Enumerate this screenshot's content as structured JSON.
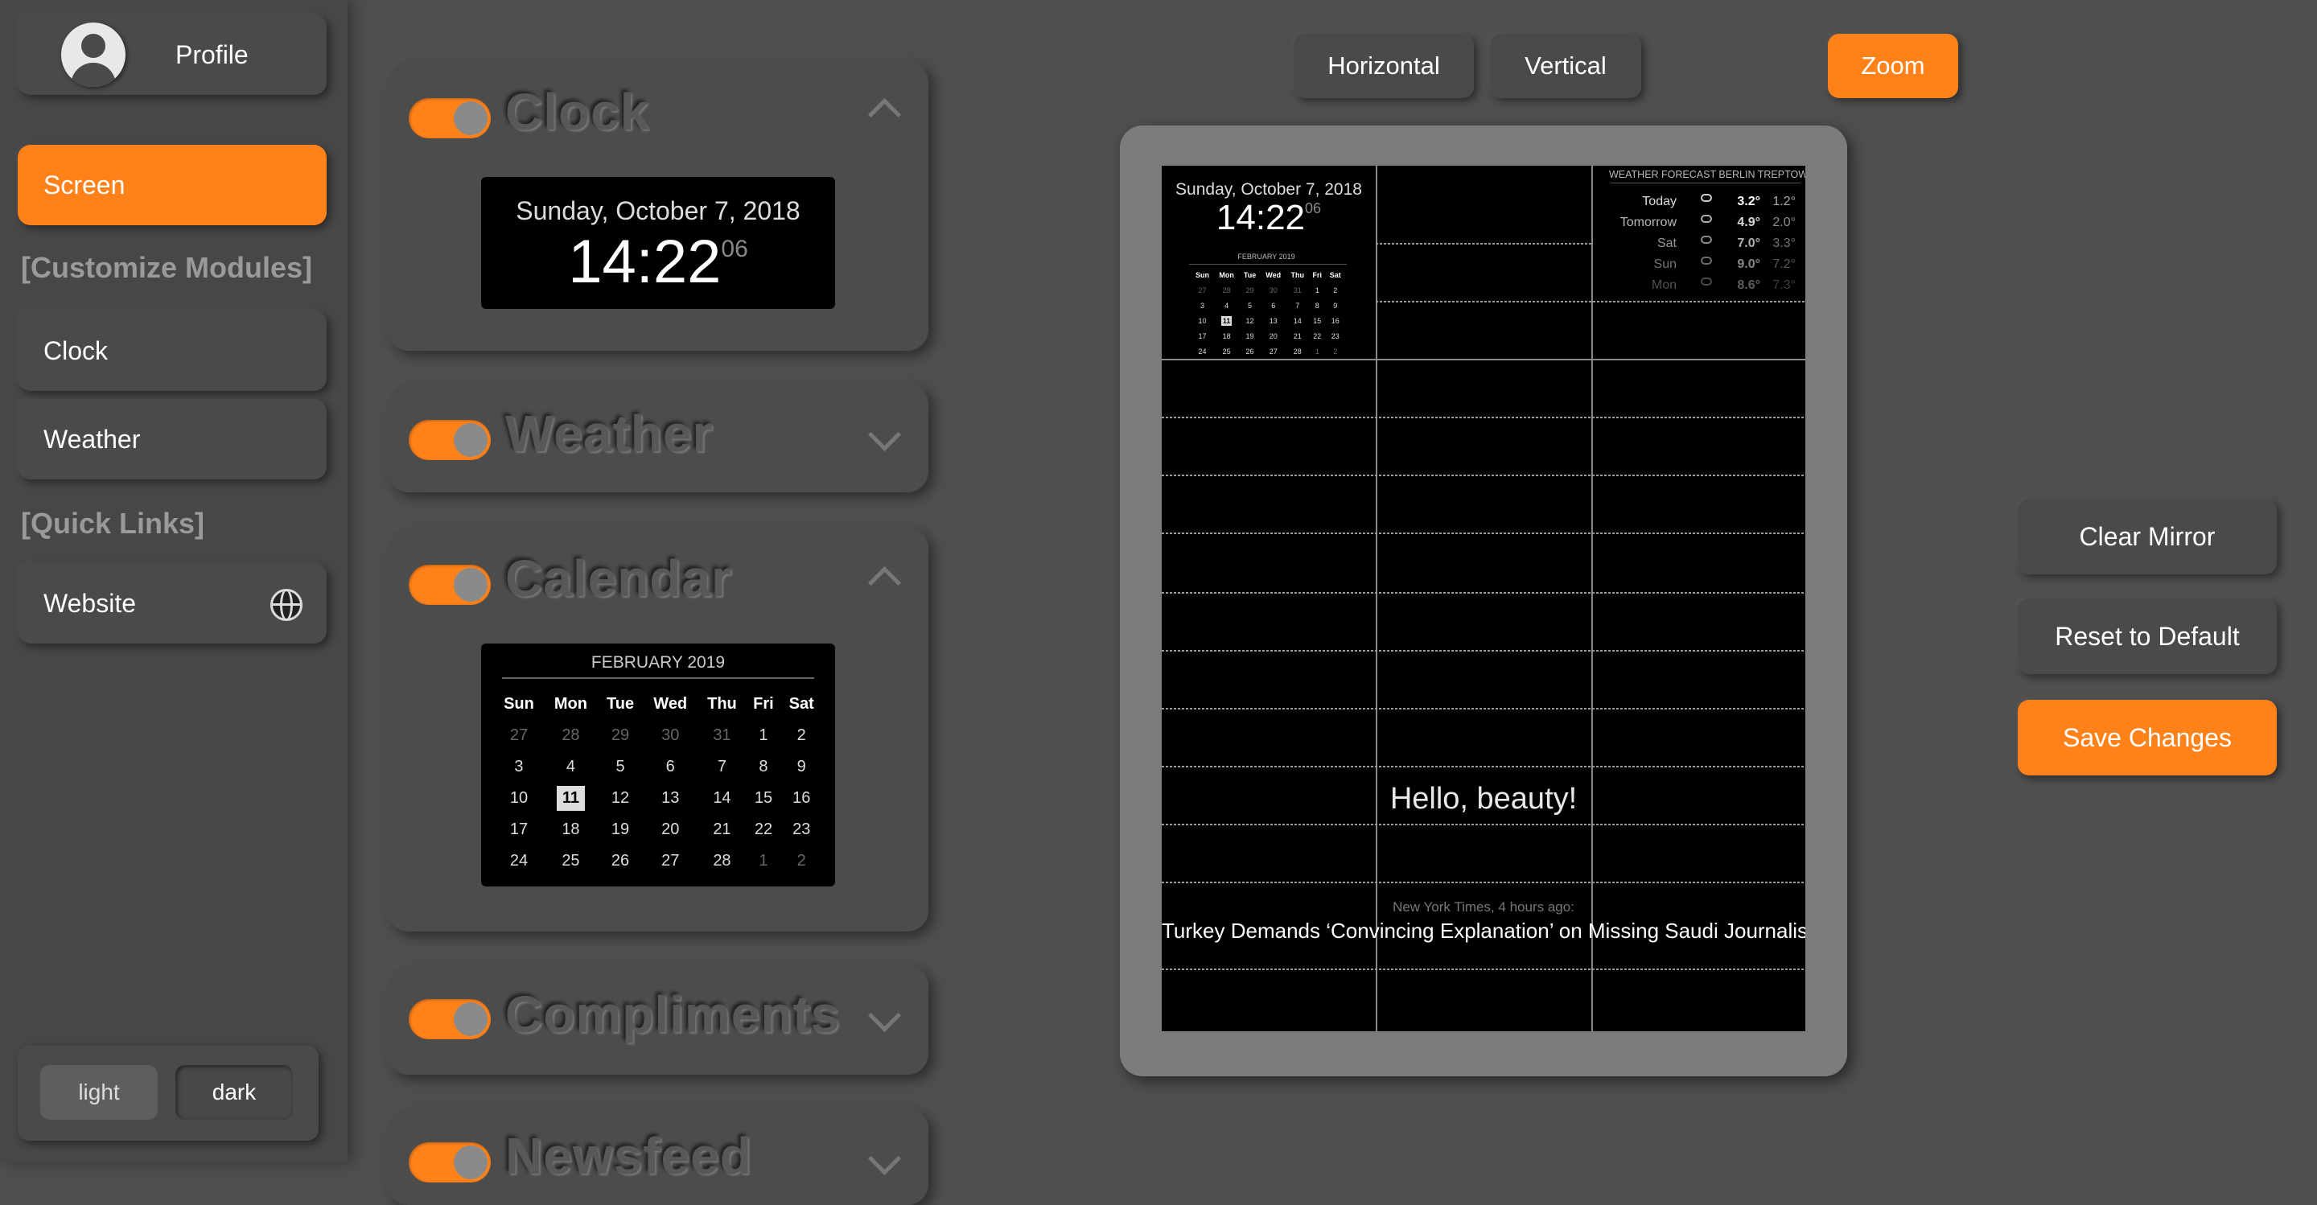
{
  "sidebar": {
    "profile_label": "Profile",
    "screen_label": "Screen",
    "section_modules": "[Customize Modules]",
    "clock_label": "Clock",
    "weather_label": "Weather",
    "section_links": "[Quick Links]",
    "website_label": "Website",
    "theme_light": "light",
    "theme_dark": "dark"
  },
  "modules": {
    "clock": "Clock",
    "weather": "Weather",
    "calendar": "Calendar",
    "compliments": "Compliments",
    "newsfeed": "Newsfeed"
  },
  "clock_preview": {
    "date": "Sunday, October 7, 2018",
    "time": "14:22",
    "seconds": "06"
  },
  "calendar_preview": {
    "month": "FEBRUARY 2019",
    "weekdays": [
      "Sun",
      "Mon",
      "Tue",
      "Wed",
      "Thu",
      "Fri",
      "Sat"
    ],
    "weeks": [
      [
        "27",
        "28",
        "29",
        "30",
        "31",
        "1",
        "2"
      ],
      [
        "3",
        "4",
        "5",
        "6",
        "7",
        "8",
        "9"
      ],
      [
        "10",
        "11",
        "12",
        "13",
        "14",
        "15",
        "16"
      ],
      [
        "17",
        "18",
        "19",
        "20",
        "21",
        "22",
        "23"
      ],
      [
        "24",
        "25",
        "26",
        "27",
        "28",
        "1",
        "2"
      ]
    ]
  },
  "toolbar": {
    "horizontal": "Horizontal",
    "vertical": "Vertical",
    "zoom": "Zoom"
  },
  "actions": {
    "clear": "Clear Mirror",
    "reset": "Reset to Default",
    "save": "Save Changes"
  },
  "mirror": {
    "date": "Sunday, October 7, 2018",
    "time": "14:22",
    "seconds": "06",
    "cal_month": "FEBRUARY 2019",
    "weather_header": "WEATHER FORECAST BERLIN TREPTOW, DE",
    "forecast": [
      {
        "day": "Today",
        "max": "3.2°",
        "min": "1.2°"
      },
      {
        "day": "Tomorrow",
        "max": "4.9°",
        "min": "2.0°"
      },
      {
        "day": "Sat",
        "max": "7.0°",
        "min": "3.3°"
      },
      {
        "day": "Sun",
        "max": "9.0°",
        "min": "7.2°"
      },
      {
        "day": "Mon",
        "max": "8.6°",
        "min": "7.3°"
      }
    ],
    "compliment": "Hello, beauty!",
    "news_source": "New York Times, 4 hours ago:",
    "news_headline": "Turkey Demands ‘Convincing Explanation’ on Missing Saudi Journalist"
  }
}
